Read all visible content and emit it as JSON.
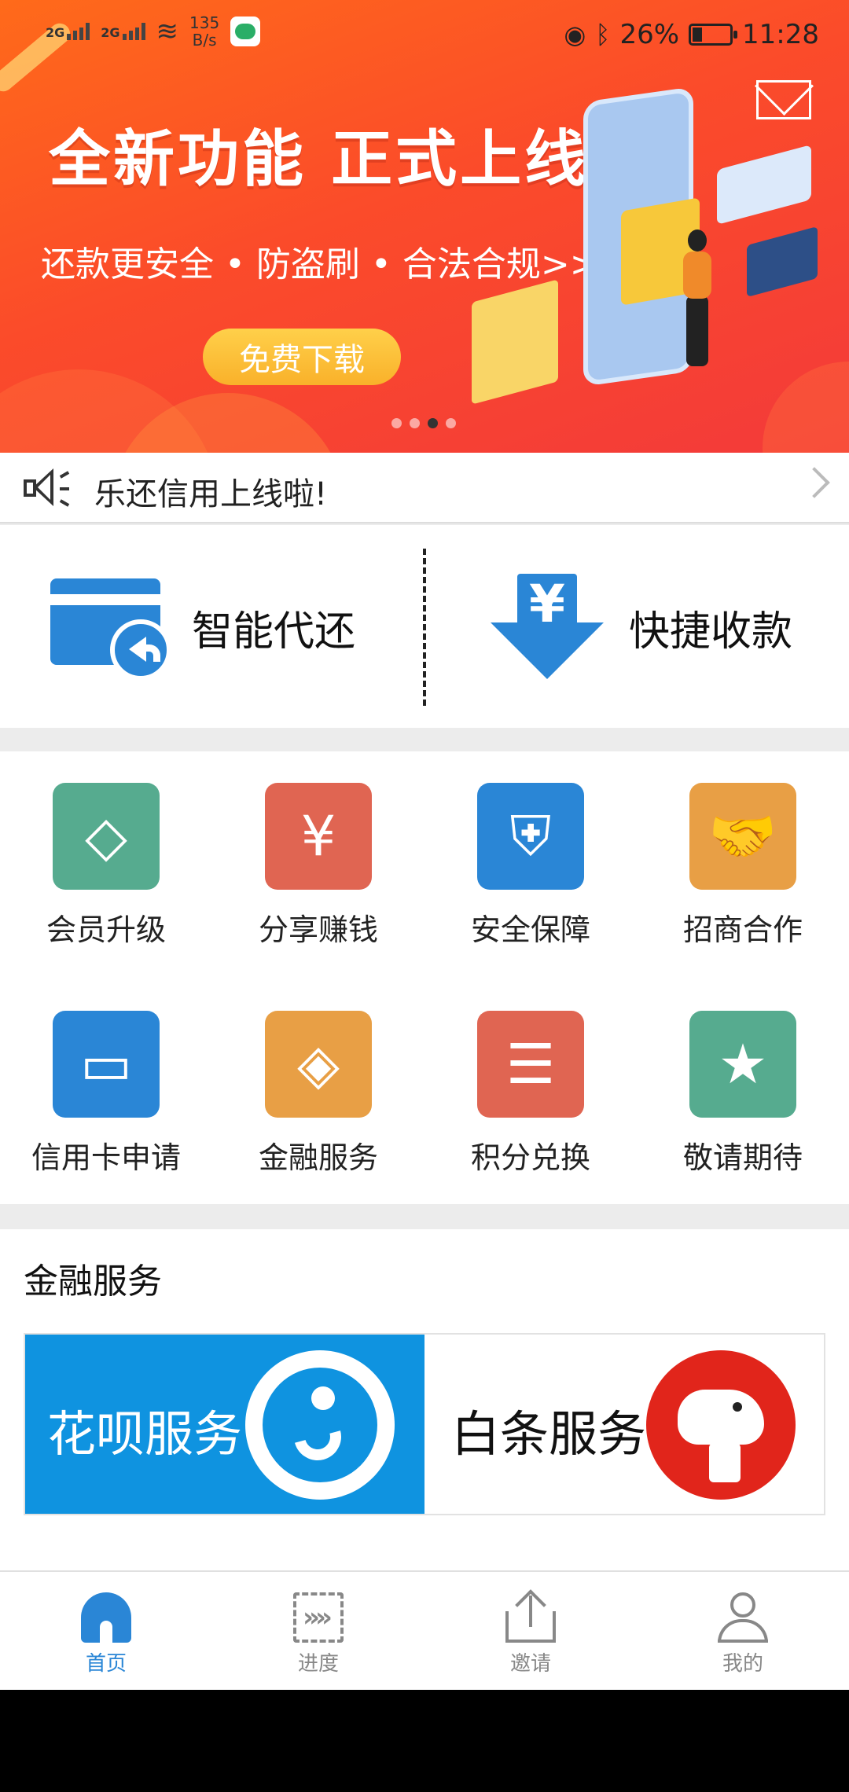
{
  "status_bar": {
    "signal1": "2G",
    "signal2": "2G",
    "speed_value": "135",
    "speed_unit": "B/s",
    "battery": "26%",
    "battery_level": 0.26,
    "time": "11:28"
  },
  "banner": {
    "title": "全新功能 正式上线",
    "subtitle": "还款更安全 • 防盗刷 • 合法合规>>",
    "button": "免费下载",
    "slides": 4,
    "active_slide": 3
  },
  "notice": {
    "text": "乐还信用上线啦!"
  },
  "main_features": [
    {
      "label": "智能代还",
      "icon": "card-return-icon"
    },
    {
      "label": "快捷收款",
      "icon": "yen-download-icon"
    }
  ],
  "services": [
    {
      "label": "会员升级",
      "icon": "diamond-icon",
      "color": "#56ab8f",
      "glyph": "◇"
    },
    {
      "label": "分享赚钱",
      "icon": "money-bag-icon",
      "color": "#e06552",
      "glyph": "¥"
    },
    {
      "label": "安全保障",
      "icon": "shield-icon",
      "color": "#2a86d6",
      "glyph": "⛨"
    },
    {
      "label": "招商合作",
      "icon": "handshake-icon",
      "color": "#e89f45",
      "glyph": "🤝"
    },
    {
      "label": "信用卡申请",
      "icon": "credit-card-icon",
      "color": "#2a86d6",
      "glyph": "▭"
    },
    {
      "label": "金融服务",
      "icon": "finance-person-icon",
      "color": "#e89f45",
      "glyph": "◈"
    },
    {
      "label": "积分兑换",
      "icon": "coins-stack-icon",
      "color": "#e06552",
      "glyph": "☰"
    },
    {
      "label": "敬请期待",
      "icon": "star-face-icon",
      "color": "#56ab8f",
      "glyph": "★"
    }
  ],
  "finance": {
    "title": "金融服务",
    "huabei": "花呗服务",
    "baitiao": "白条服务"
  },
  "tabbar": [
    {
      "label": "首页",
      "icon": "home-icon",
      "active": true
    },
    {
      "label": "进度",
      "icon": "progress-icon",
      "active": false
    },
    {
      "label": "邀请",
      "icon": "share-icon",
      "active": false
    },
    {
      "label": "我的",
      "icon": "user-icon",
      "active": false
    }
  ]
}
